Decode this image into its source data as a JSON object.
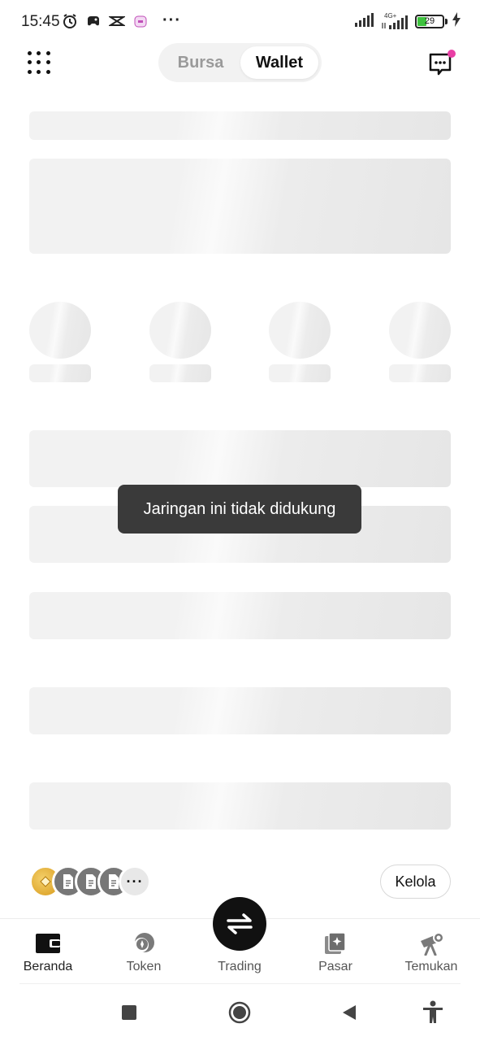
{
  "status_bar": {
    "time": "15:45",
    "battery_level": "29",
    "network_label": "4G+",
    "icons": [
      "alarm-icon",
      "game-controller-icon",
      "capcut-icon",
      "app-icon",
      "more-dots-icon",
      "signal-icon",
      "signal-4g-icon",
      "battery-icon",
      "charging-icon"
    ]
  },
  "header": {
    "tabs": [
      {
        "label": "Bursa",
        "active": false
      },
      {
        "label": "Wallet",
        "active": true
      }
    ],
    "has_notification": true
  },
  "toast": {
    "message": "Jaringan ini tidak didukung"
  },
  "chains": {
    "icons": [
      "gold-chain-icon",
      "document-chain-icon",
      "document-chain-icon",
      "document-chain-icon"
    ],
    "more_label": "···",
    "manage_label": "Kelola"
  },
  "bottom_nav": {
    "items": [
      {
        "label": "Beranda",
        "icon": "wallet-icon",
        "active": true
      },
      {
        "label": "Token",
        "icon": "token-icon",
        "active": false
      },
      {
        "label": "Trading",
        "icon": "swap-icon",
        "active": false
      },
      {
        "label": "Pasar",
        "icon": "marketplace-icon",
        "active": false
      },
      {
        "label": "Temukan",
        "icon": "telescope-icon",
        "active": false
      }
    ]
  },
  "colors": {
    "accent_dot": "#e93fa5",
    "toast_bg": "#3a3a3a",
    "battery_fill": "#3ec23e"
  }
}
